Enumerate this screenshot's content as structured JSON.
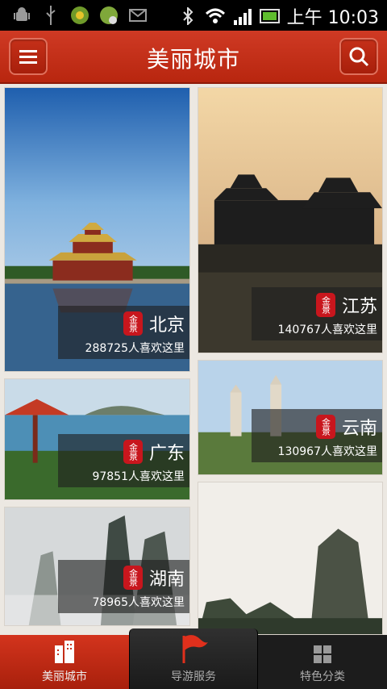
{
  "status_bar": {
    "time": "上午 10:03"
  },
  "header": {
    "title": "美丽城市"
  },
  "cities": [
    {
      "name": "北京",
      "likes": "288725人喜欢这里"
    },
    {
      "name": "江苏",
      "likes": "140767人喜欢这里"
    },
    {
      "name": "广东",
      "likes": "97851人喜欢这里"
    },
    {
      "name": "云南",
      "likes": "130967人喜欢这里"
    },
    {
      "name": "湖南",
      "likes": "78965人喜欢这里"
    }
  ],
  "seal_text": "金景",
  "bottom_nav": [
    {
      "label": "美丽城市",
      "active": true
    },
    {
      "label": "导游服务",
      "active": false
    },
    {
      "label": "特色分类",
      "active": false
    }
  ],
  "colors": {
    "accent": "#c8301a",
    "nav_bg": "#1c1c1c"
  }
}
